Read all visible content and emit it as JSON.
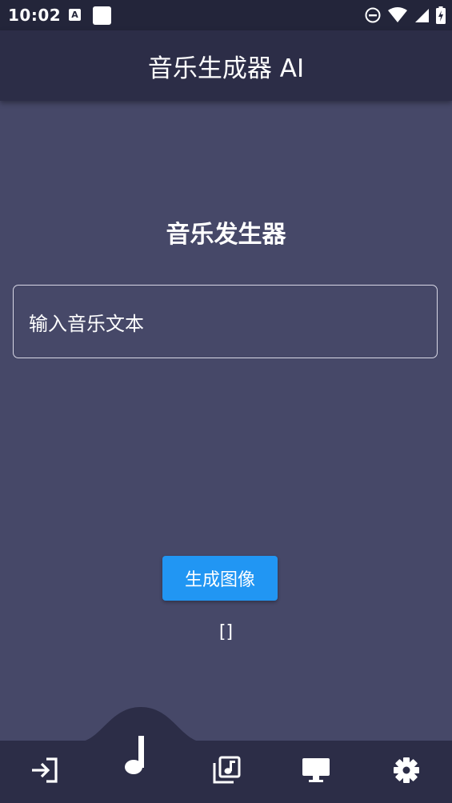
{
  "status_bar": {
    "time": "10:02",
    "a_badge": "A",
    "icons": [
      "do-not-disturb-icon",
      "wifi-icon",
      "signal-icon",
      "battery-charging-icon"
    ]
  },
  "app_bar": {
    "title": "音乐生成器 AI"
  },
  "main": {
    "heading": "音乐发生器",
    "input_placeholder": "输入音乐文本",
    "generate_button_label": "生成图像",
    "result_text": "[]"
  },
  "bottom_nav": {
    "items": [
      "login-icon",
      "music-note-icon",
      "music-library-icon",
      "desktop-icon",
      "settings-icon"
    ],
    "active": "music-note-icon"
  },
  "colors": {
    "background": "#464868",
    "app_bar": "#2c2d47",
    "status_bar": "#23253a",
    "accent": "#2196f3"
  }
}
